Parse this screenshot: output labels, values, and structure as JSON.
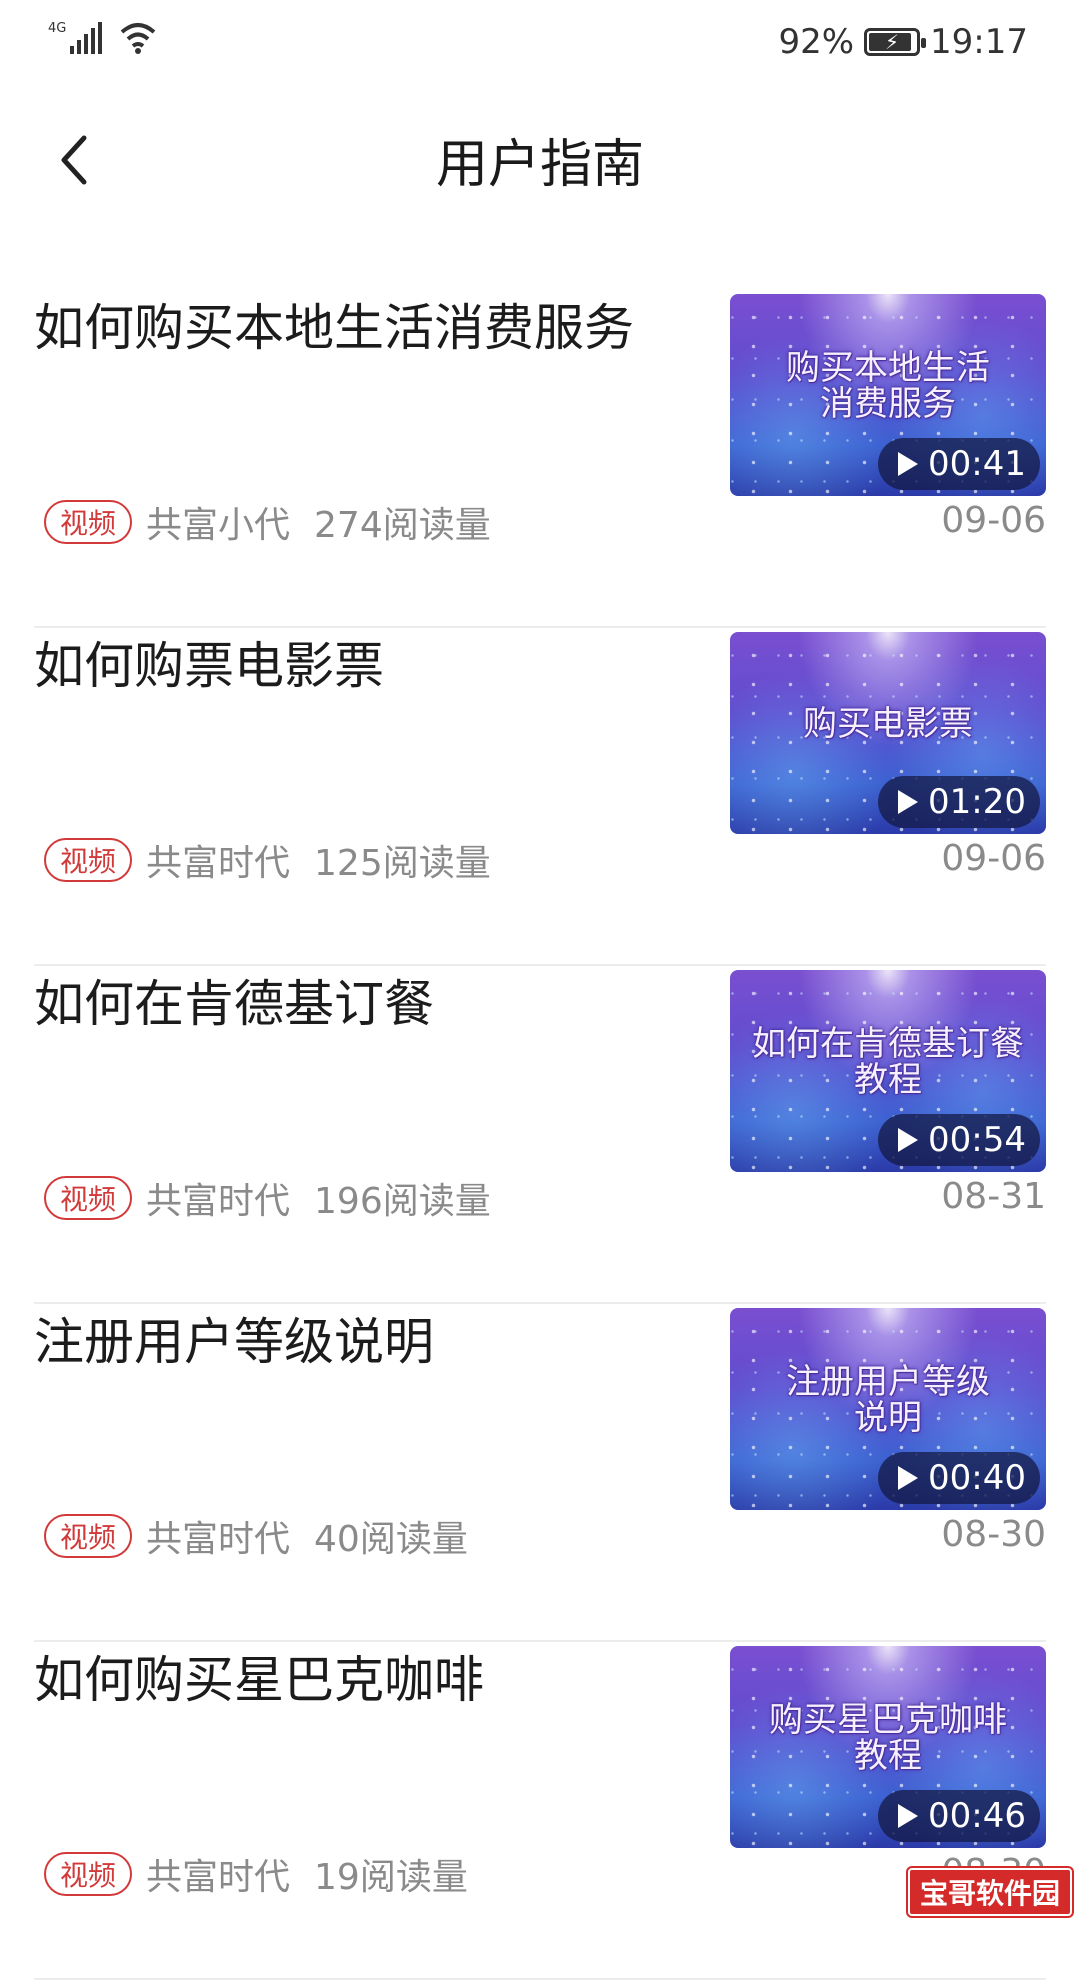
{
  "status_bar": {
    "network": "4G",
    "battery_percent": "92%",
    "battery_level": 0.92,
    "time": "19:17"
  },
  "nav": {
    "title": "用户指南"
  },
  "items": [
    {
      "title": "如何购买本地生活消费服务",
      "tag": "视频",
      "author": "共富小代",
      "reads": "274阅读量",
      "date": "09-06",
      "thumb_text": "购买本地生活\n消费服务",
      "duration": "00:41"
    },
    {
      "title": "如何购票电影票",
      "tag": "视频",
      "author": "共富时代",
      "reads": "125阅读量",
      "date": "09-06",
      "thumb_text": "购买电影票",
      "duration": "01:20"
    },
    {
      "title": "如何在肯德基订餐",
      "tag": "视频",
      "author": "共富时代",
      "reads": "196阅读量",
      "date": "08-31",
      "thumb_text": "如何在肯德基订餐\n教程",
      "duration": "00:54"
    },
    {
      "title": "注册用户等级说明",
      "tag": "视频",
      "author": "共富时代",
      "reads": "40阅读量",
      "date": "08-30",
      "thumb_text": "注册用户等级\n说明",
      "duration": "00:40"
    },
    {
      "title": "如何购买星巴克咖啡",
      "tag": "视频",
      "author": "共富时代",
      "reads": "19阅读量",
      "date": "08-30",
      "thumb_text": "购买星巴克咖啡\n教程",
      "duration": "00:46"
    }
  ],
  "watermark": "宝哥软件园"
}
